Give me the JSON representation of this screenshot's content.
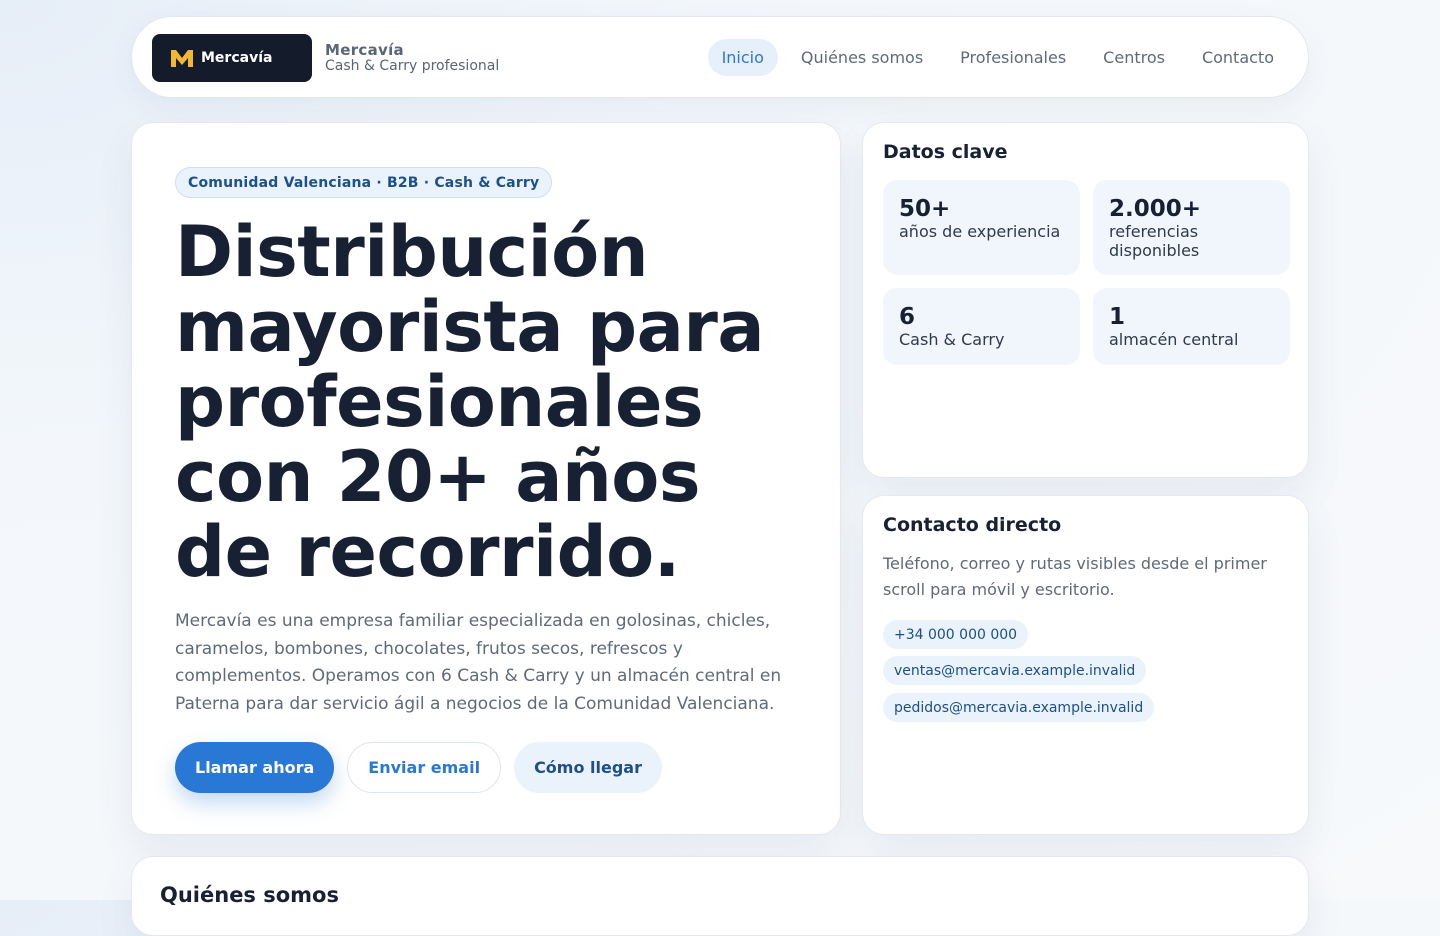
{
  "header": {
    "logo_text": "Mercavía",
    "brand_name": "Mercavía",
    "brand_tagline": "Cash & Carry profesional",
    "nav": [
      "Inicio",
      "Quiénes somos",
      "Profesionales",
      "Centros",
      "Contacto"
    ],
    "active_nav": "Inicio"
  },
  "hero": {
    "tag": "Comunidad Valenciana · B2B · Cash & Carry",
    "title": "Distribución mayorista para profesionales con 20+ años de recorrido.",
    "description": "Mercavía es una empresa familiar especializada en golosinas, chicles, caramelos, bombones, chocolates, frutos secos, refrescos y complementos. Operamos con 6 Cash & Carry y un almacén central en Paterna para dar servicio ágil a negocios de la Comunidad Valenciana.",
    "buttons": {
      "call": "Llamar ahora",
      "email": "Enviar email",
      "directions": "Cómo llegar"
    }
  },
  "stats": {
    "title": "Datos clave",
    "items": [
      {
        "value": "50+",
        "label": "años de experiencia"
      },
      {
        "value": "2.000+",
        "label": "referencias disponibles"
      },
      {
        "value": "6",
        "label": "Cash & Carry"
      },
      {
        "value": "1",
        "label": "almacén central"
      }
    ]
  },
  "contact": {
    "title": "Contacto directo",
    "description": "Teléfono, correo y rutas visibles desde el primer scroll para móvil y escritorio.",
    "phone": "+34 000 000 000",
    "email_sales": "ventas@mercavia.example.invalid",
    "email_orders": "pedidos@mercavia.example.invalid"
  },
  "about": {
    "title": "Quiénes somos"
  },
  "colors": {
    "accent": "#2a78d6",
    "logo_bg": "#141c2c",
    "logo_mark": "#f2b632",
    "soft_blue": "#eaf3fc"
  }
}
